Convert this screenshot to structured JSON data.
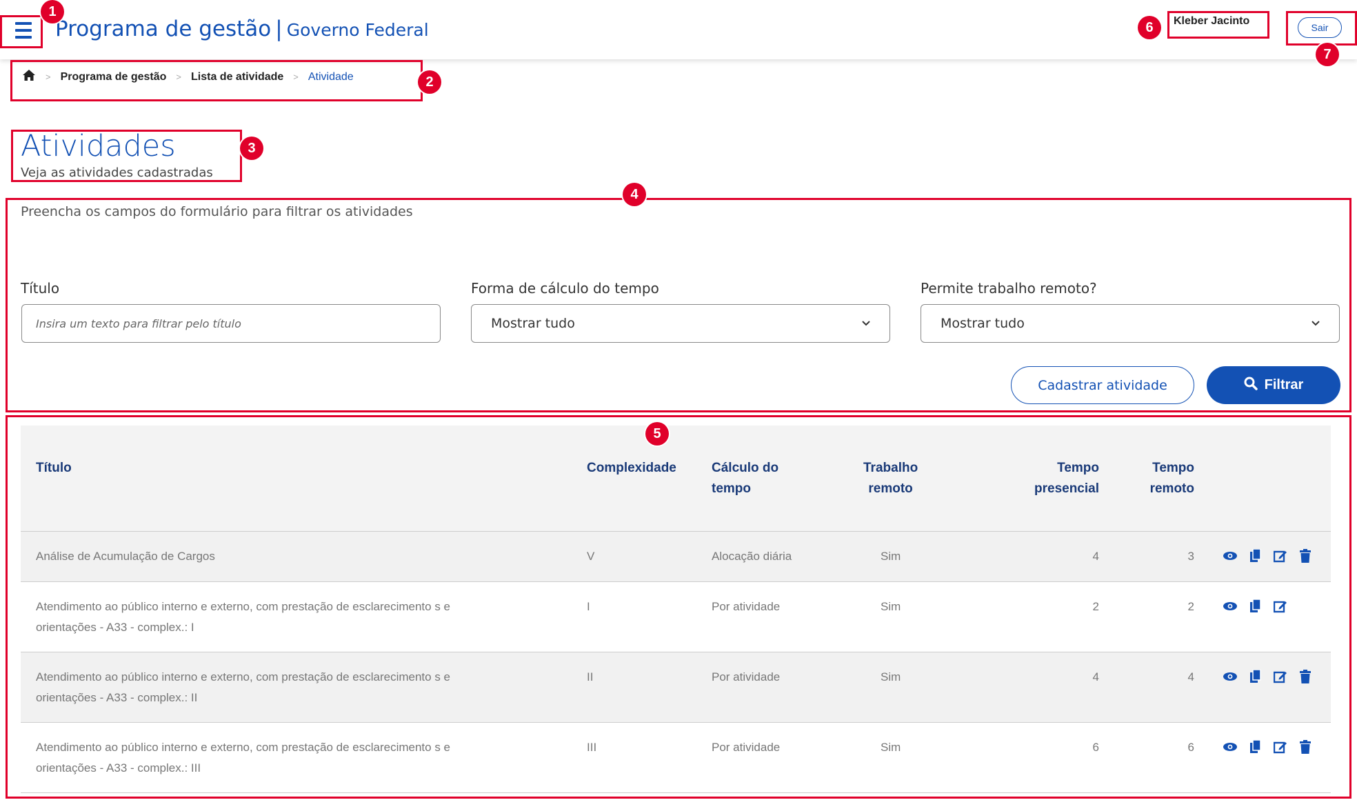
{
  "header": {
    "app_title": "Programa de gestão",
    "separator": "|",
    "org": "Governo Federal",
    "user_name": "Kleber Jacinto",
    "logout_label": "Sair"
  },
  "breadcrumb": {
    "home_icon": "home-icon",
    "items": [
      "Programa de gestão",
      "Lista de atividade"
    ],
    "current": "Atividade",
    "separator": ">"
  },
  "page": {
    "title": "Atividades",
    "subtitle": "Veja as atividades cadastradas"
  },
  "filter": {
    "hint": "Preencha os campos do formulário para filtrar os atividades",
    "title_label": "Título",
    "title_placeholder": "Insira um texto para filtrar pelo título",
    "calc_label": "Forma de cálculo do tempo",
    "calc_value": "Mostrar tudo",
    "remote_label": "Permite trabalho remoto?",
    "remote_value": "Mostrar tudo",
    "register_label": "Cadastrar atividade",
    "filter_label": "Filtrar"
  },
  "table": {
    "headers": {
      "titulo": "Título",
      "complexidade": "Complexidade",
      "calculo_1": "Cálculo do",
      "calculo_2": "tempo",
      "trabalho_1": "Trabalho",
      "trabalho_2": "remoto",
      "presencial_1": "Tempo",
      "presencial_2": "presencial",
      "remoto_1": "Tempo",
      "remoto_2": "remoto"
    },
    "rows": [
      {
        "titulo_1": "Análise de Acumulação de Cargos",
        "titulo_2": "",
        "complexidade": "V",
        "calculo": "Alocação diária",
        "remoto": "Sim",
        "tempo_presencial": "4",
        "tempo_remoto": "3",
        "delete": true
      },
      {
        "titulo_1": "Atendimento ao público interno e externo, com prestação de esclarecimento s e",
        "titulo_2": "orientações - A33 - complex.: I",
        "complexidade": "I",
        "calculo": "Por atividade",
        "remoto": "Sim",
        "tempo_presencial": "2",
        "tempo_remoto": "2",
        "delete": false
      },
      {
        "titulo_1": "Atendimento ao público interno e externo, com prestação de esclarecimento s e",
        "titulo_2": "orientações - A33 - complex.: II",
        "complexidade": "II",
        "calculo": "Por atividade",
        "remoto": "Sim",
        "tempo_presencial": "4",
        "tempo_remoto": "4",
        "delete": true
      },
      {
        "titulo_1": "Atendimento ao público interno e externo, com prestação de esclarecimento s e",
        "titulo_2": "orientações - A33 - complex.: III",
        "complexidade": "III",
        "calculo": "Por atividade",
        "remoto": "Sim",
        "tempo_presencial": "6",
        "tempo_remoto": "6",
        "delete": true
      }
    ]
  },
  "annotations": [
    "1",
    "2",
    "3",
    "4",
    "5",
    "6",
    "7"
  ],
  "colors": {
    "primary": "#1351b4",
    "annotation": "#e0002a",
    "header_bg": "#f3f3f3"
  }
}
